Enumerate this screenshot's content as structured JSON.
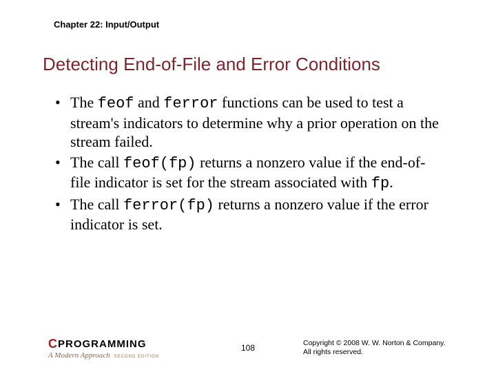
{
  "chapter": "Chapter 22: Input/Output",
  "title": "Detecting End-of-File and Error Conditions",
  "bullets": [
    {
      "pre1": "The ",
      "code1": "feof",
      "mid1": " and ",
      "code2": "ferror",
      "post": " functions can be used to test a stream's indicators to determine why a prior operation on the stream failed."
    },
    {
      "pre1": "The call ",
      "code1": "feof(fp)",
      "mid1": " returns a nonzero value if the end-of-file indicator is set for the stream associated with ",
      "code2": "fp",
      "post": "."
    },
    {
      "pre1": "The call ",
      "code1": "ferror(fp)",
      "mid1": " returns a nonzero value if the error indicator is set.",
      "code2": "",
      "post": ""
    }
  ],
  "logo": {
    "c": "C",
    "rest": "PROGRAMMING",
    "sub": "A Modern Approach",
    "edition": "SECOND EDITION"
  },
  "page": "108",
  "copyright": {
    "line1": "Copyright © 2008 W. W. Norton & Company.",
    "line2": "All rights reserved."
  }
}
